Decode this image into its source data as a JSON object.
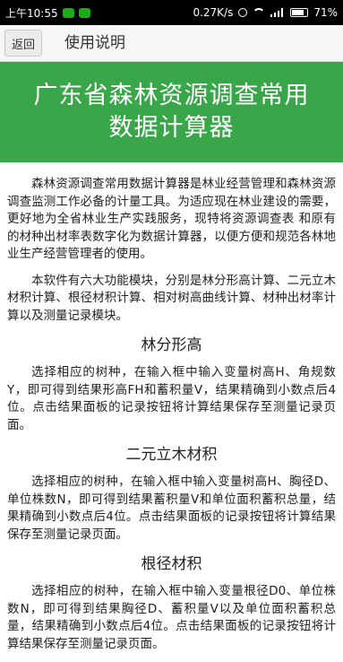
{
  "status_bar": {
    "time": "上午10:55",
    "net_speed": "0.27K/s",
    "battery": "71%"
  },
  "app_bar": {
    "back_label": "返回",
    "title": "使用说明"
  },
  "banner": {
    "line1": "广东省森林资源调查常用",
    "line2": "数据计算器"
  },
  "content": {
    "intro": "森林资源调查常用数据计算器是林业经营管理和森林资源调查监测工作必备的计量工具。为适应现在林业建设的需要，更好地为全省林业生产实践服务，现特将资源调查表 和原有的材种出材率表数字化为数据计算器，以便方便和规范各林地业生产经营管理者的使用。",
    "modules": "本软件有六大功能模块，分别是林分形高计算、二元立木材积计算、根径材积计算、相对树高曲线计算、材种出材率计算以及测量记录模块。",
    "sections": [
      {
        "title": "林分形高",
        "text": "选择相应的树种，在输入框中输入变量树高H、角规数Y，即可得到结果形高FH和蓄积量V，结果精确到小数点后4位。点击结果面板的记录按钮将计算结果保存至测量记录页面。"
      },
      {
        "title": "二元立木材积",
        "text": "选择相应的树种，在输入框中输入变量树高H、胸径D、单位株数N，即可得到结果蓄积量V和单位面积蓄积总量，结果精确到小数点后4位。点击结果面板的记录按钮将计算结果保存至测量记录页面。"
      },
      {
        "title": "根径材积",
        "text": "选择相应的树种，在输入框中输入变量根径D0、单位株数N，即可得到结果胸径D、蓄积量V以及单位面积蓄积总量，结果精确到小数点后4位。点击结果面板的记录按钮将计算结果保存至测量记录页面。"
      }
    ]
  }
}
